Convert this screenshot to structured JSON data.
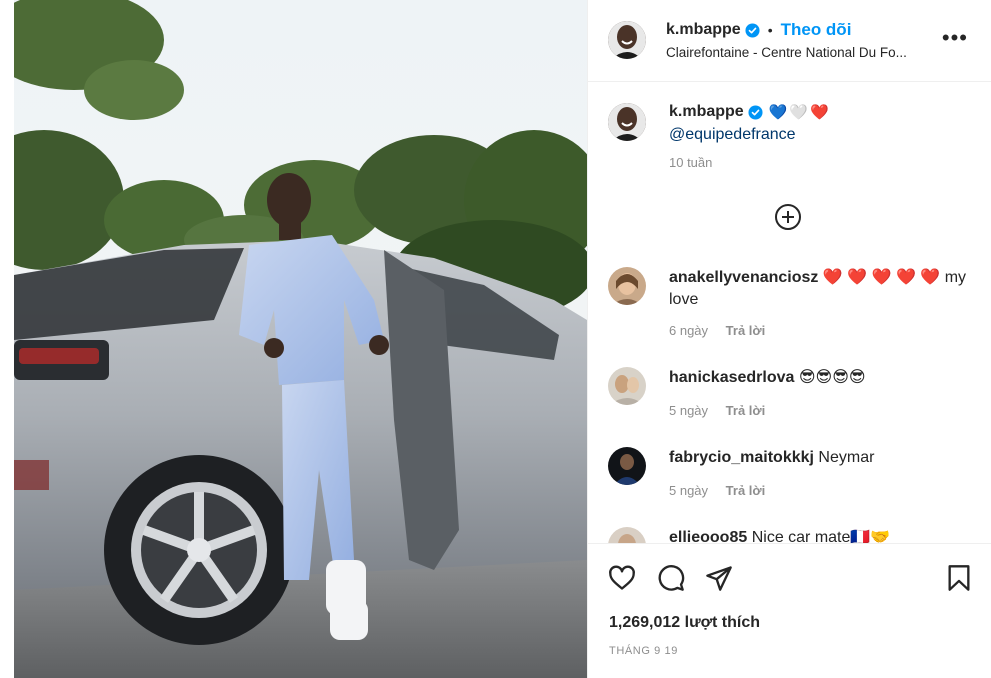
{
  "post": {
    "username": "k.mbappe",
    "follow_label": "Theo dõi",
    "separator": "•",
    "location": "Clairefontaine - Centre National Du Fo...",
    "more_label": "•••",
    "photo_alt": "Man stepping out of a silver car"
  },
  "caption": {
    "username": "k.mbappe",
    "hearts": "💙🤍❤️",
    "mention": "@equipedefrance",
    "time": "10 tuần"
  },
  "comments": [
    {
      "username": "anakellyvenanciosz",
      "text": "❤️ ❤️ ❤️ ❤️ ❤️ my love",
      "time": "6 ngày",
      "reply": "Trả lời"
    },
    {
      "username": "hanickasedrlova",
      "text": "😎😎😎😎",
      "time": "5 ngày",
      "reply": "Trả lời"
    },
    {
      "username": "fabrycio_maitokkkj",
      "text": "Neymar",
      "time": "5 ngày",
      "reply": "Trả lời"
    },
    {
      "username": "ellieooo85",
      "text": "Nice car mate🇫🇷🤝",
      "time": "",
      "reply": ""
    }
  ],
  "actions": {
    "likes": "1,269,012 lượt thích",
    "date": "THÁNG 9 19"
  },
  "colors": {
    "accent": "#0095f6",
    "text": "#262626",
    "secondary": "#8e8e8e",
    "link": "#00376b"
  },
  "icons": [
    "verified-icon",
    "more-options-icon",
    "add-comment-icon",
    "heart-icon",
    "comment-icon",
    "share-icon",
    "bookmark-icon"
  ]
}
